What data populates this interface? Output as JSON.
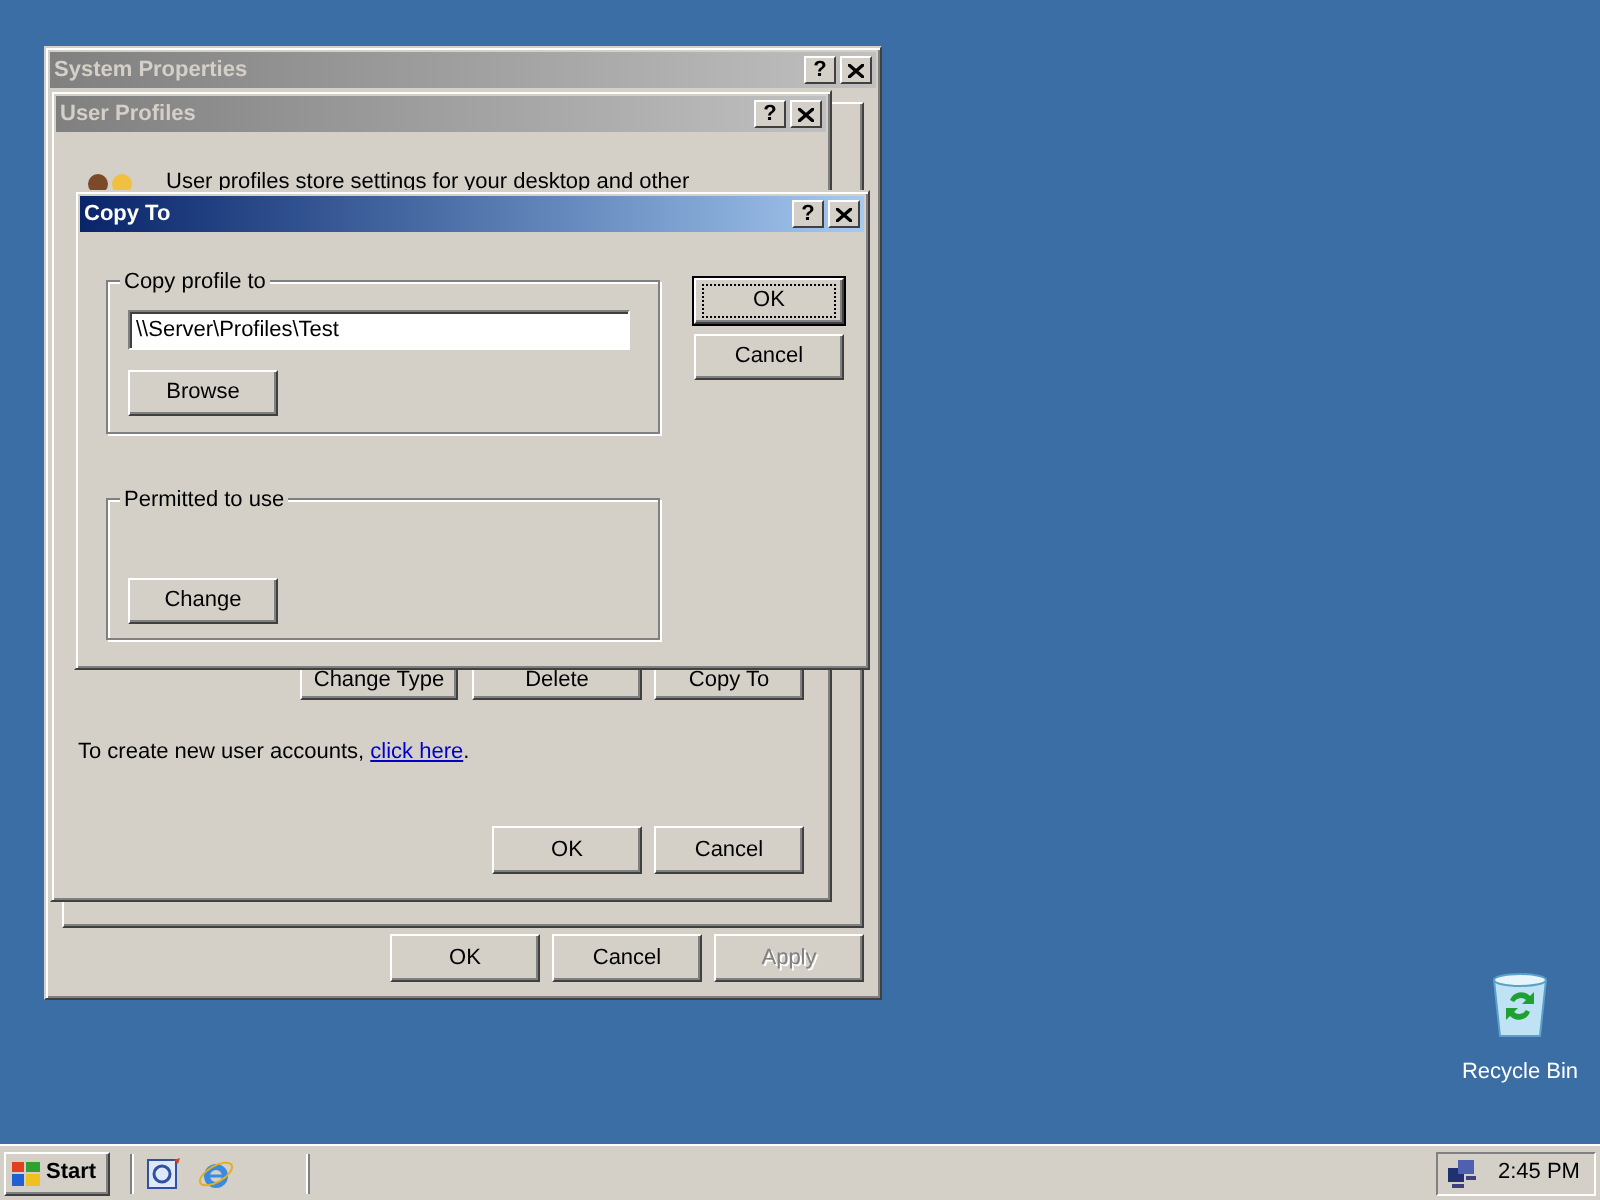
{
  "desktop": {
    "icons": [
      {
        "label": "Recycle Bin"
      }
    ]
  },
  "windows": [
    {
      "kind": "system_properties",
      "title": "System Properties",
      "active": false,
      "help_button": "?",
      "buttons": [
        {
          "label": "OK",
          "disabled": false
        },
        {
          "label": "Cancel",
          "disabled": false
        },
        {
          "label": "Apply",
          "disabled": true
        }
      ]
    },
    {
      "kind": "user_profiles",
      "title": "User Profiles",
      "active": false,
      "help_button": "?",
      "description": "User profiles store settings for your desktop and other",
      "profile_buttons": [
        {
          "label": "Change Type"
        },
        {
          "label": "Delete"
        },
        {
          "label": "Copy To"
        }
      ],
      "create_text": "To create new user accounts, ",
      "create_link": "click here",
      "create_after": ".",
      "buttons": [
        {
          "label": "OK",
          "disabled": false
        },
        {
          "label": "Cancel",
          "disabled": false
        }
      ]
    },
    {
      "kind": "copy_to",
      "title": "Copy To",
      "active": true,
      "help_button": "?",
      "copy_group": {
        "legend": "Copy profile to",
        "value": "\\\\Server\\Profiles\\Test",
        "button": {
          "label": "Browse"
        }
      },
      "permit_group": {
        "legend": "Permitted to use",
        "button": {
          "label": "Change"
        }
      },
      "buttons": [
        {
          "label": "OK",
          "default": true
        },
        {
          "label": "Cancel",
          "default": false
        }
      ]
    }
  ],
  "taskbar": {
    "start": "Start",
    "clock": "2:45 PM"
  }
}
